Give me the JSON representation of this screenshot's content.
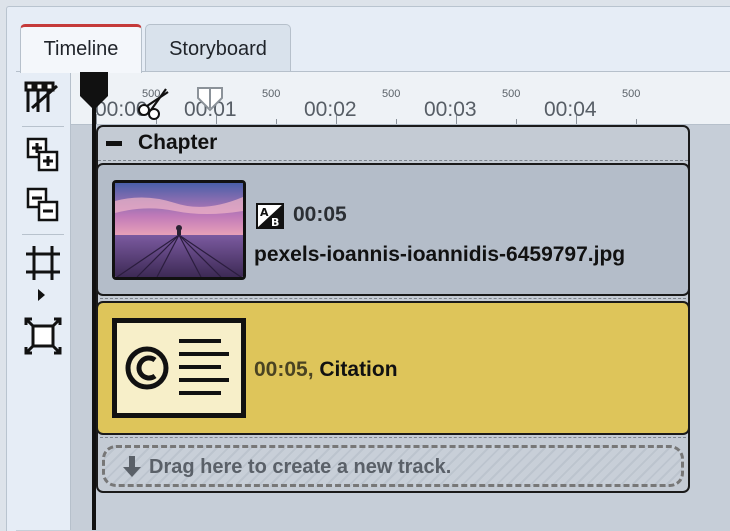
{
  "tabs": [
    {
      "label": "Timeline",
      "active": true
    },
    {
      "label": "Storyboard",
      "active": false
    }
  ],
  "toolbar": {
    "icons": [
      "multi-track-tool-icon",
      "add-tracks-icon",
      "remove-tracks-icon",
      "crop-range-icon",
      "fit-frame-icon"
    ]
  },
  "ruler": {
    "major_labels": [
      "00:00",
      "00:01",
      "00:02",
      "00:03",
      "00:04"
    ],
    "minor_label": "500",
    "minor_labels_visible": [
      "500",
      "500",
      "500",
      "500",
      "500"
    ]
  },
  "chapter": {
    "title": "Chapter"
  },
  "tracks": [
    {
      "type": "image",
      "duration": "00:05",
      "filename": "pexels-ioannis-ioannidis-6459797.jpg",
      "icon": "text-overlay-ab-icon"
    },
    {
      "type": "citation",
      "duration": "00:05,",
      "name": "Citation",
      "icon": "copyright-icon"
    }
  ],
  "dropzone": {
    "label": "Drag here to create a new track."
  },
  "colors": {
    "active_tab_accent": "#c53a3a",
    "citation_track": "#dec55a",
    "image_track": "#b4bdc9"
  }
}
